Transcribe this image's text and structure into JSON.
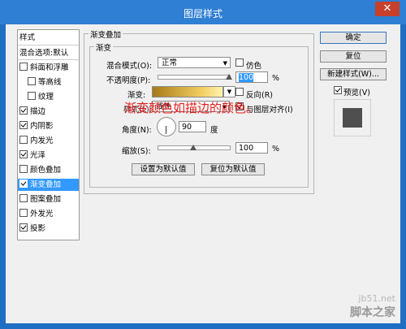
{
  "window": {
    "title": "图层样式",
    "close": "✕"
  },
  "sidebar": {
    "header": "样式",
    "items": [
      {
        "label": "混合选项:默认",
        "checkbox": false,
        "checked": false,
        "indent": false,
        "selected": false
      },
      {
        "label": "斜面和浮雕",
        "checkbox": true,
        "checked": false,
        "indent": false,
        "selected": false
      },
      {
        "label": "等高线",
        "checkbox": true,
        "checked": false,
        "indent": true,
        "selected": false
      },
      {
        "label": "纹理",
        "checkbox": true,
        "checked": false,
        "indent": true,
        "selected": false
      },
      {
        "label": "描边",
        "checkbox": true,
        "checked": true,
        "indent": false,
        "selected": false
      },
      {
        "label": "内阴影",
        "checkbox": true,
        "checked": true,
        "indent": false,
        "selected": false
      },
      {
        "label": "内发光",
        "checkbox": true,
        "checked": false,
        "indent": false,
        "selected": false
      },
      {
        "label": "光泽",
        "checkbox": true,
        "checked": true,
        "indent": false,
        "selected": false
      },
      {
        "label": "颜色叠加",
        "checkbox": true,
        "checked": false,
        "indent": false,
        "selected": false
      },
      {
        "label": "渐变叠加",
        "checkbox": true,
        "checked": true,
        "indent": false,
        "selected": true
      },
      {
        "label": "图案叠加",
        "checkbox": true,
        "checked": false,
        "indent": false,
        "selected": false
      },
      {
        "label": "外发光",
        "checkbox": true,
        "checked": false,
        "indent": false,
        "selected": false
      },
      {
        "label": "投影",
        "checkbox": true,
        "checked": true,
        "indent": false,
        "selected": false
      }
    ]
  },
  "main": {
    "group_title": "渐变叠加",
    "sub_title": "渐变",
    "blend_mode_label": "混合模式(O):",
    "blend_mode_value": "正常",
    "dither_label": "仿色",
    "opacity_label": "不透明度(P):",
    "opacity_value": "100",
    "opacity_unit": "%",
    "opacity_level": 1.0,
    "gradient_label": "渐变:",
    "reverse_label": "反向(R)",
    "style_label": "样式(L):",
    "style_value": "线性",
    "align_label": "与图层对齐(I)",
    "angle_label": "角度(N):",
    "angle_value": "90",
    "angle_unit": "度",
    "scale_label": "缩放(S):",
    "scale_value": "100",
    "scale_unit": "%",
    "scale_level": 0.5,
    "set_default": "设置为默认值",
    "reset_default": "复位为默认值",
    "annotation": "渐变颜色如描边的颜色。"
  },
  "right": {
    "ok": "确定",
    "reset": "复位",
    "new_style": "新建样式(W)...",
    "preview_label": "预览(V)",
    "preview_checked": true
  },
  "watermark": {
    "line1": "jb51.net",
    "line2": "脚本之家"
  },
  "colors": {
    "accent": "#3399ff",
    "titlebar": "#2f7fd4",
    "annotation": "#e31b1b",
    "close": "#c7402b"
  }
}
